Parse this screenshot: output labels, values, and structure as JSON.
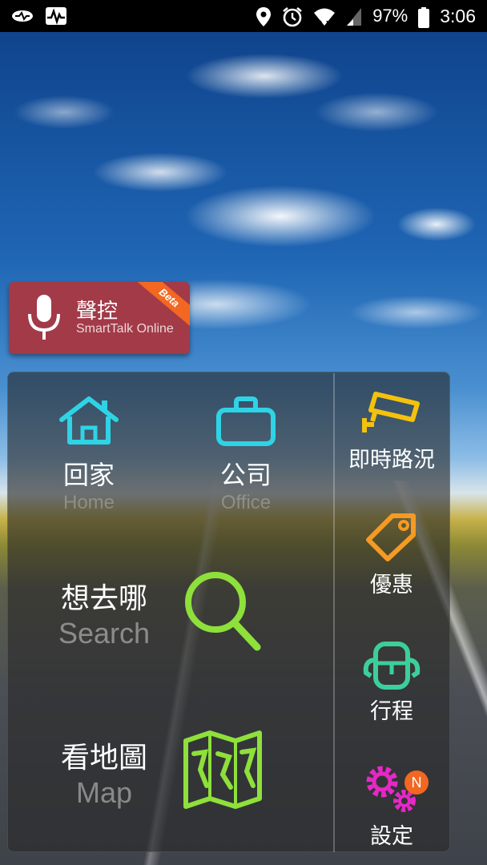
{
  "status_bar": {
    "left_icons": [
      "link-icon",
      "activity-icon"
    ],
    "right_icons": [
      "location-icon",
      "alarm-icon",
      "wifi-icon",
      "signal-icon",
      "battery-icon"
    ],
    "battery": "97%",
    "time": "3:06"
  },
  "voice_card": {
    "icon": "microphone-icon",
    "title": "聲控",
    "subtitle": "SmartTalk Online",
    "badge": "Beta"
  },
  "tiles": {
    "home": {
      "label": "回家",
      "sublabel": "Home",
      "icon": "home-icon",
      "color": "#2fd3e6"
    },
    "office": {
      "label": "公司",
      "sublabel": "Office",
      "icon": "briefcase-icon",
      "color": "#2fd3e6"
    },
    "search": {
      "label": "想去哪",
      "sublabel": "Search",
      "icon": "search-icon",
      "color": "#8ee03a"
    },
    "map": {
      "label": "看地圖",
      "sublabel": "Map",
      "icon": "map-icon",
      "color": "#8ee03a"
    }
  },
  "side_menu": [
    {
      "label": "即時路況",
      "icon": "traffic-camera-icon",
      "color": "#f4c20d"
    },
    {
      "label": "優惠",
      "icon": "tag-icon",
      "color": "#f59a23"
    },
    {
      "label": "行程",
      "icon": "backpack-icon",
      "color": "#3ccf9c"
    },
    {
      "label": "設定",
      "icon": "gear-icon",
      "color": "#e628c6",
      "badge": "N"
    }
  ]
}
